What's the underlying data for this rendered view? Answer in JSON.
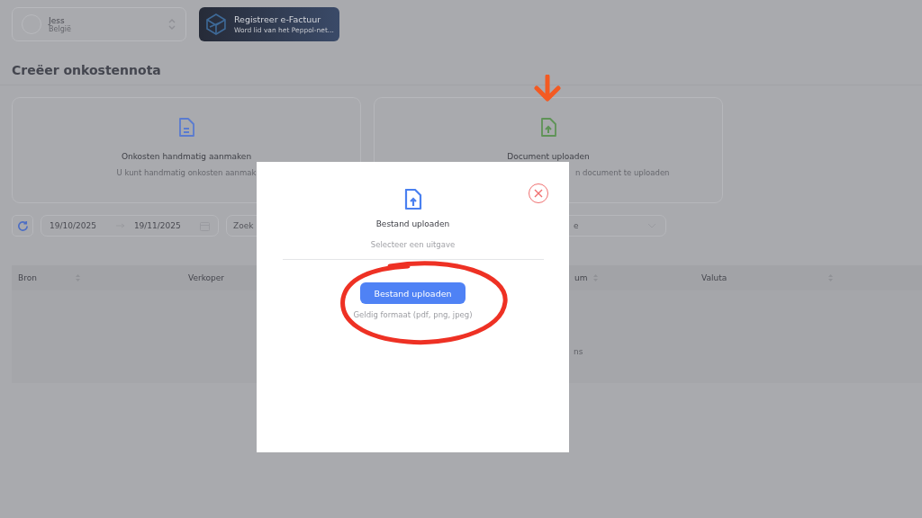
{
  "account": {
    "name": "Jess",
    "country": "België"
  },
  "promo": {
    "title": "Registreer e-Factuur",
    "subtitle": "Word lid van het Peppol-net..."
  },
  "page_title": "Creëer onkostennota",
  "cards": [
    {
      "kind": "manual",
      "title": "Onkosten handmatig aanmaken",
      "subtitle": "U kunt handmatig onkosten aanmak"
    },
    {
      "kind": "upload",
      "title": "Document uploaden",
      "subtitle": "n document te uploaden"
    }
  ],
  "filters": {
    "date_from": "19/10/2025",
    "date_to": "19/11/2025",
    "search_placeholder": "Zoek",
    "select_placeholder": "e"
  },
  "table": {
    "columns": [
      {
        "label": "Bron",
        "sortable": true
      },
      {
        "label": "Verkoper",
        "sortable": false
      },
      {
        "label": "um",
        "sortable": true
      },
      {
        "label": "Valuta",
        "sortable": true
      }
    ],
    "empty_text": "ns"
  },
  "modal": {
    "title": "Bestand uploaden",
    "subtitle": "Selecteer een uitgave",
    "button": "Bestand uploaden",
    "hint": "Geldig formaat (pdf, png, jpeg)"
  }
}
